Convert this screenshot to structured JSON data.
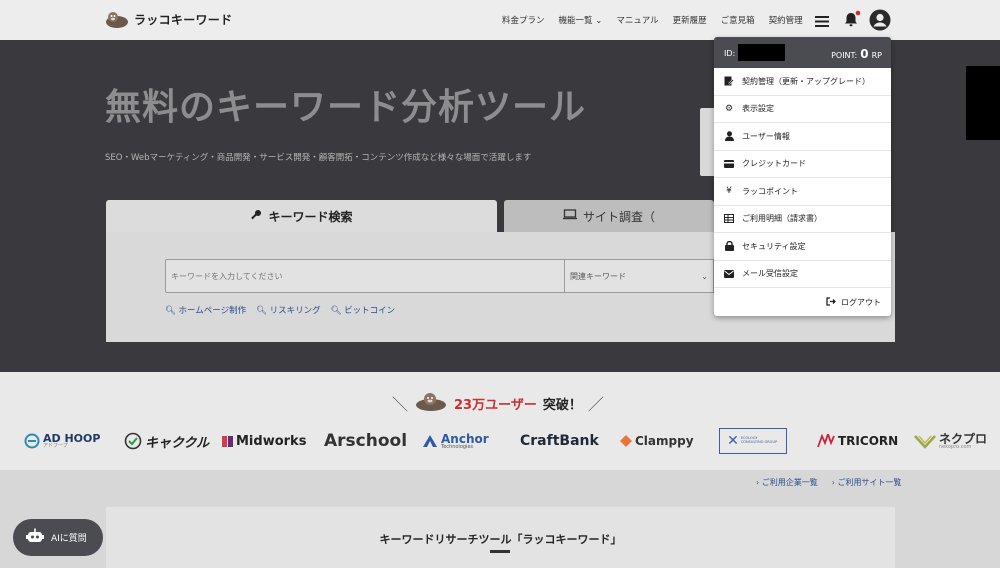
{
  "header": {
    "logo_text": "ラッコキーワード",
    "nav": [
      "料金プラン",
      "機能一覧",
      "マニュアル",
      "更新履歴",
      "ご意見箱",
      "契約管理"
    ]
  },
  "hero": {
    "title": "無料のキーワード分析ツール",
    "subtitle": "SEO・Webマーケティング・商品開発・サービス開発・顧客開拓・コンテンツ作成など様々な場面で活躍します",
    "tab_keyword": "キーワード検索",
    "tab_site": "サイト調査（",
    "search_placeholder": "キーワードを入力してください",
    "select_value": "関連キーワード",
    "suggestions": [
      "ホームページ制作",
      "リスキリング",
      "ビットコイン"
    ]
  },
  "users": {
    "count": "23万ユーザー",
    "suffix": "突破！",
    "open_slash": "＼",
    "close_slash": "／"
  },
  "client_logos": {
    "adhoop": "AD HOOP",
    "adhoop_sub": "アドフープ",
    "kyakuru": "キャククル",
    "midworks": "Midworks",
    "arschool": "Arschool",
    "anchor": "Anchor",
    "anchor_sub": "Technologies",
    "craftbank": "CraftBank",
    "clamppy": "Clamppy",
    "xx": "ECOLOGY CONSULTING GROUP",
    "tricorn": "TRICORN",
    "nekopuro": "ネクプロ",
    "nekopuro_sub": "nekopro.com"
  },
  "lower": {
    "links": [
      "ご利用企業一覧",
      "ご利用サイト一覧"
    ],
    "title": "キーワードリサーチツール「ラッコキーワード」"
  },
  "ai_button": "AIに質問",
  "dropdown": {
    "id_label": "ID:",
    "point_label": "POINT:",
    "point_value": "0",
    "point_unit": "RP",
    "items": [
      {
        "label": "契約管理（更新・アップグレード）",
        "icon": "contract-icon"
      },
      {
        "label": "表示設定",
        "icon": "gear-icon"
      },
      {
        "label": "ユーザー情報",
        "icon": "user-icon"
      },
      {
        "label": "クレジットカード",
        "icon": "credit-card-icon"
      },
      {
        "label": "ラッコポイント",
        "icon": "yen-icon"
      },
      {
        "label": "ご利用明細（請求書）",
        "icon": "table-icon"
      },
      {
        "label": "セキュリティ設定",
        "icon": "lock-icon"
      },
      {
        "label": "メール受信設定",
        "icon": "envelope-icon"
      }
    ],
    "logout": "ログアウト"
  },
  "colors": {
    "hero_bg": "#3a3a3e",
    "dropdown_header": "#4a4c52",
    "accent_red": "#c8312f",
    "link_blue": "#2a4d8c"
  }
}
